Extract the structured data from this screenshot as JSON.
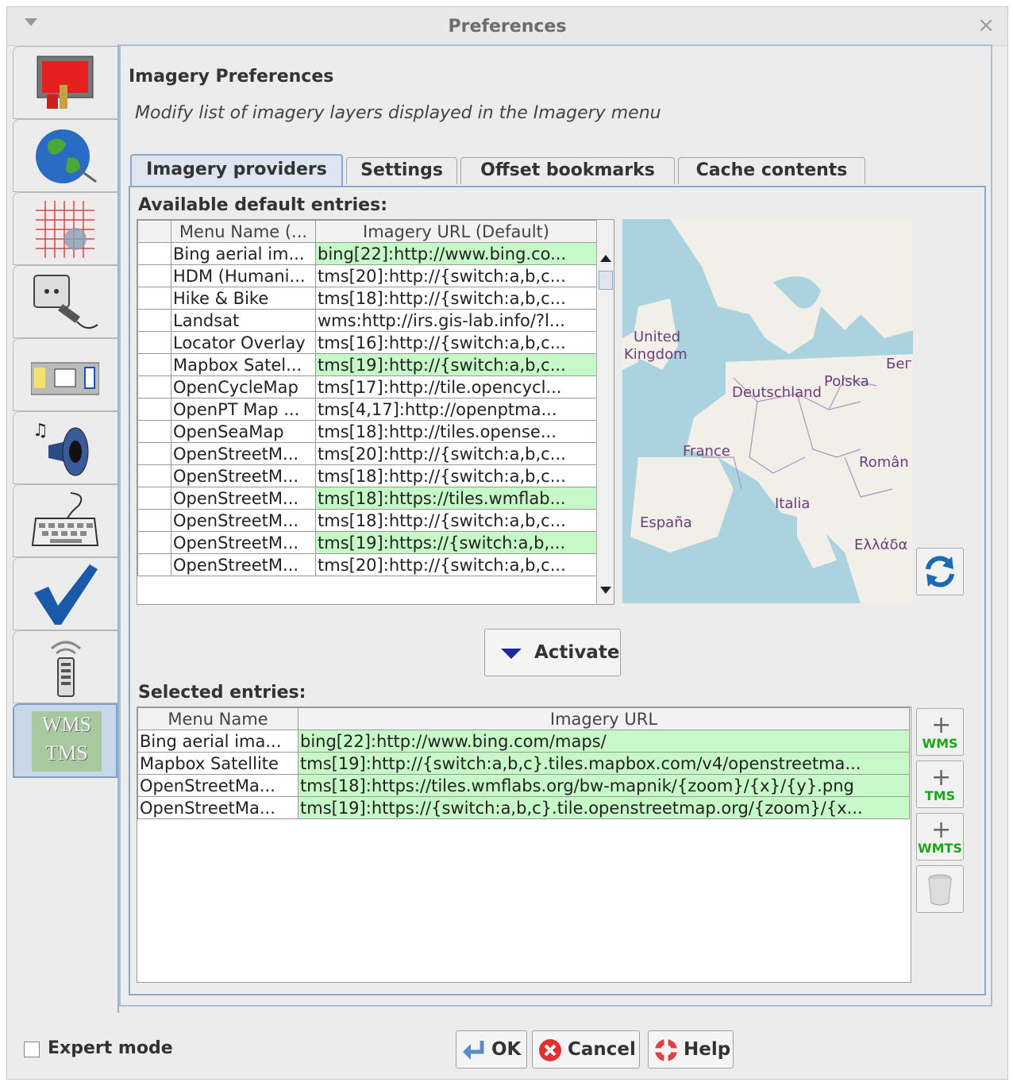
{
  "window": {
    "title": "Preferences"
  },
  "sidebar": {
    "items": [
      {
        "name": "display-settings-icon",
        "active": false
      },
      {
        "name": "globe-icon",
        "active": false
      },
      {
        "name": "projection-grid-icon",
        "active": false
      },
      {
        "name": "plugin-plug-icon",
        "active": false
      },
      {
        "name": "toolbar-icon",
        "active": false
      },
      {
        "name": "audio-speaker-icon",
        "active": false
      },
      {
        "name": "keyboard-icon",
        "active": false
      },
      {
        "name": "checkmark-icon",
        "active": false
      },
      {
        "name": "remote-control-icon",
        "active": false
      },
      {
        "name": "wms-tms-icon",
        "active": true,
        "label_line1": "WMS",
        "label_line2": "TMS"
      }
    ]
  },
  "main": {
    "heading": "Imagery Preferences",
    "subheading": "Modify list of imagery layers displayed in the Imagery menu",
    "tabs": [
      {
        "label": "Imagery providers",
        "active": true
      },
      {
        "label": "Settings",
        "active": false
      },
      {
        "label": "Offset bookmarks",
        "active": false
      },
      {
        "label": "Cache contents",
        "active": false
      }
    ]
  },
  "available": {
    "label": "Available default entries:",
    "columns": [
      "",
      "Menu Name (...",
      "Imagery URL (Default)"
    ],
    "rows": [
      {
        "name": "Bing aerial im...",
        "url": "bing[22]:http://www.bing.co...",
        "selected": true
      },
      {
        "name": "HDM (Humani...",
        "url": "tms[20]:http://{switch:a,b,c...",
        "selected": false
      },
      {
        "name": "Hike & Bike",
        "url": "tms[18]:http://{switch:a,b,c...",
        "selected": false
      },
      {
        "name": "Landsat",
        "url": "wms:http://irs.gis-lab.info/?l...",
        "selected": false
      },
      {
        "name": "Locator Overlay",
        "url": "tms[16]:http://{switch:a,b,c...",
        "selected": false
      },
      {
        "name": "Mapbox Satel...",
        "url": "tms[19]:http://{switch:a,b,c...",
        "selected": true
      },
      {
        "name": "OpenCycleMap",
        "url": "tms[17]:http://tile.opencycl...",
        "selected": false
      },
      {
        "name": "OpenPT Map ...",
        "url": "tms[4,17]:http://openptma...",
        "selected": false
      },
      {
        "name": "OpenSeaMap",
        "url": "tms[18]:http://tiles.opense...",
        "selected": false
      },
      {
        "name": "OpenStreetM...",
        "url": "tms[20]:http://{switch:a,b,c...",
        "selected": false
      },
      {
        "name": "OpenStreetM...",
        "url": "tms[18]:http://{switch:a,b,c...",
        "selected": false
      },
      {
        "name": "OpenStreetM...",
        "url": "tms[18]:https://tiles.wmflab...",
        "selected": true
      },
      {
        "name": "OpenStreetM...",
        "url": "tms[18]:http://{switch:a,b,c...",
        "selected": false
      },
      {
        "name": "OpenStreetM...",
        "url": "tms[19]:https://{switch:a,b,...",
        "selected": true
      },
      {
        "name": "OpenStreetM...",
        "url": "tms[20]:http://{switch:a,b,c...",
        "selected": false
      }
    ]
  },
  "map": {
    "labels": [
      "United",
      "Kingdom",
      "Deutschland",
      "Polska",
      "Бег",
      "France",
      "Român",
      "Italia",
      "España",
      "Ελλάδα"
    ]
  },
  "activate": {
    "label": "Activate"
  },
  "selected": {
    "label": "Selected entries:",
    "columns": [
      "Menu Name",
      "Imagery URL"
    ],
    "rows": [
      {
        "name": "Bing aerial ima...",
        "url": "bing[22]:http://www.bing.com/maps/"
      },
      {
        "name": "Mapbox Satellite",
        "url": "tms[19]:http://{switch:a,b,c}.tiles.mapbox.com/v4/openstreetma..."
      },
      {
        "name": "OpenStreetMa...",
        "url": "tms[18]:https://tiles.wmflabs.org/bw-mapnik/{zoom}/{x}/{y}.png"
      },
      {
        "name": "OpenStreetMa...",
        "url": "tms[19]:https://{switch:a,b,c}.tile.openstreetmap.org/{zoom}/{x..."
      }
    ],
    "buttons": {
      "wms": "WMS",
      "tms": "TMS",
      "wmts": "WMTS"
    }
  },
  "footer": {
    "expert_label": "Expert mode",
    "ok_label": "OK",
    "cancel_label": "Cancel",
    "help_label": "Help"
  },
  "colors": {
    "accent": "#8ca8c8",
    "selected_cell": "#c7f8c7",
    "map_water": "#aad3df",
    "map_land": "#f2efe9"
  }
}
